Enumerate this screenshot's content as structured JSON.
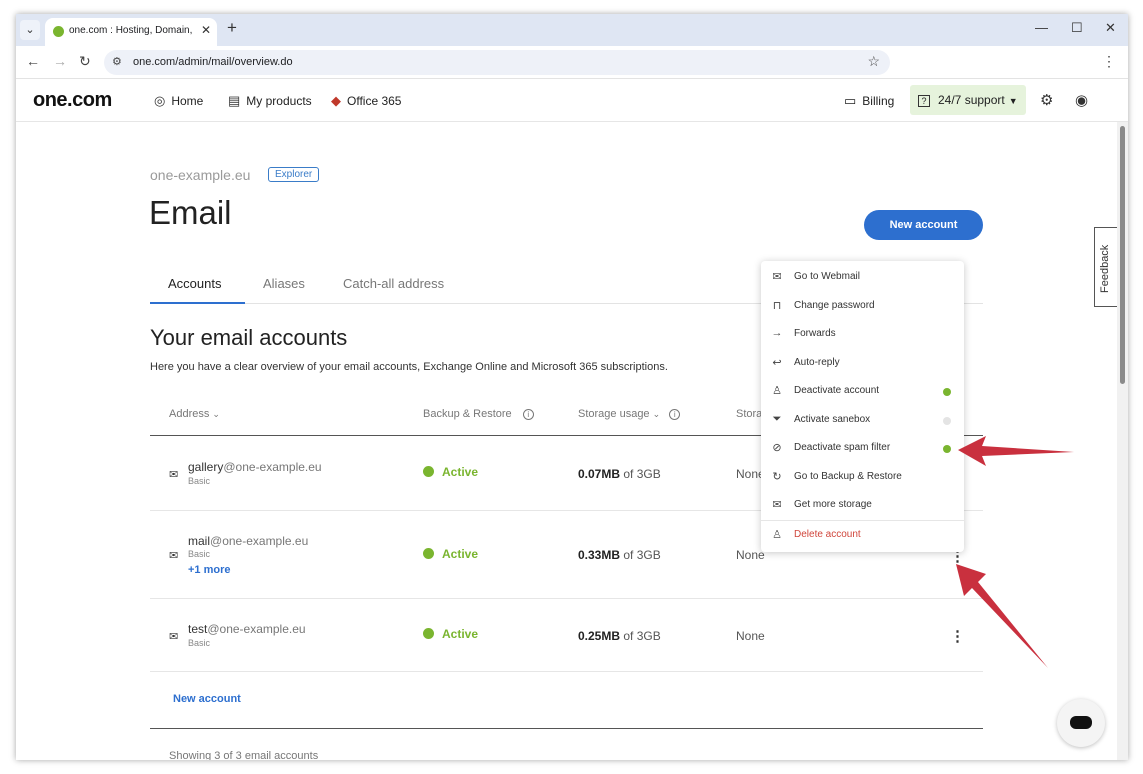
{
  "browser": {
    "tab_title": "one.com : Hosting, Domain, Email",
    "url": "one.com/admin/mail/overview.do"
  },
  "header": {
    "logo": "one.com",
    "nav": [
      "Home",
      "My products",
      "Office 365"
    ],
    "billing": "Billing",
    "support": "24/7 support"
  },
  "page": {
    "domain": "one-example.eu",
    "plan_badge": "Explorer",
    "title": "Email",
    "new_account_button": "New account",
    "tabs": [
      "Accounts",
      "Aliases",
      "Catch-all address"
    ],
    "section_title": "Your email accounts",
    "section_desc": "Here you have a clear overview of your email accounts, Exchange Online and Microsoft 365 subscriptions."
  },
  "table": {
    "columns": [
      "Address",
      "Backup & Restore",
      "Storage usage",
      "Stora"
    ],
    "rows": [
      {
        "local": "gallery",
        "domain": "@one-example.eu",
        "plan": "Basic",
        "more": "",
        "status": "Active",
        "used": "0.07MB",
        "of": "of 3GB",
        "storage": "None"
      },
      {
        "local": "mail",
        "domain": "@one-example.eu",
        "plan": "Basic",
        "more": "+1 more",
        "status": "Active",
        "used": "0.33MB",
        "of": "of 3GB",
        "storage": "None"
      },
      {
        "local": "test",
        "domain": "@one-example.eu",
        "plan": "Basic",
        "more": "",
        "status": "Active",
        "used": "0.25MB",
        "of": "of 3GB",
        "storage": "None"
      }
    ],
    "new_account_link": "New account",
    "showing": "Showing 3 of 3 email accounts"
  },
  "menu": {
    "items": [
      {
        "label": "Go to Webmail",
        "icon": "mail-icon",
        "toggle": null
      },
      {
        "label": "Change password",
        "icon": "lock-icon",
        "toggle": null
      },
      {
        "label": "Forwards",
        "icon": "arrow-right-icon",
        "toggle": null
      },
      {
        "label": "Auto-reply",
        "icon": "reply-icon",
        "toggle": null
      },
      {
        "label": "Deactivate account",
        "icon": "person-icon",
        "toggle": "on"
      },
      {
        "label": "Activate sanebox",
        "icon": "filter-icon",
        "toggle": "off"
      },
      {
        "label": "Deactivate spam filter",
        "icon": "block-icon",
        "toggle": "on"
      },
      {
        "label": "Go to Backup & Restore",
        "icon": "restore-icon",
        "toggle": null
      },
      {
        "label": "Get more storage",
        "icon": "mail-icon",
        "toggle": null
      },
      {
        "label": "Delete account",
        "icon": "person-remove-icon",
        "toggle": null
      }
    ]
  },
  "feedback": "Feedback",
  "colors": {
    "brand_blue": "#2d6fcf",
    "active_green": "#7ab52f",
    "support_bg": "#e6f3dc",
    "danger": "#d0453b",
    "annotation_red": "#c41e2e"
  }
}
